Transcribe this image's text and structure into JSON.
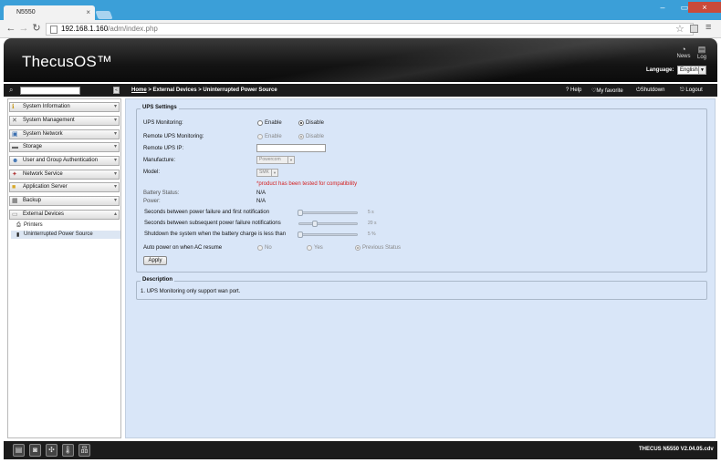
{
  "browser": {
    "tab_title": "N5550",
    "url_host": "192.168.1.160",
    "url_path": "/adm/index.php"
  },
  "header": {
    "logo": "ThecusOS™",
    "news": "News",
    "log": "Log",
    "language_label": "Language:",
    "language_value": "English"
  },
  "toolbar": {
    "breadcrumb_home": "Home",
    "breadcrumb_rest": " > External Devices > Uninterrupted Power Source",
    "help": "Help",
    "favorite": "My favorite",
    "shutdown": "Shutdown",
    "logout": "Logout"
  },
  "sidebar": {
    "items": [
      {
        "label": "System Information"
      },
      {
        "label": "System Management"
      },
      {
        "label": "System Network"
      },
      {
        "label": "Storage"
      },
      {
        "label": "User and Group Authentication"
      },
      {
        "label": "Network Service"
      },
      {
        "label": "Application Server"
      },
      {
        "label": "Backup"
      },
      {
        "label": "External Devices"
      }
    ],
    "sub_items": [
      {
        "label": "Printers"
      },
      {
        "label": "Uninterrupted Power Source"
      }
    ]
  },
  "ups": {
    "legend": "UPS Settings",
    "monitoring_label": "UPS Monitoring:",
    "enable": "Enable",
    "disable": "Disable",
    "remote_monitoring_label": "Remote UPS Monitoring:",
    "remote_ip_label": "Remote UPS IP:",
    "remote_ip_value": "",
    "manufacture_label": "Manufacture:",
    "manufacture_value": "Powercom",
    "model_label": "Model:",
    "model_value": "SMK",
    "compat_note": "*product has been tested for compatibility",
    "battery_label": "Battery Status:",
    "battery_value": "N/A",
    "power_label": "Power:",
    "power_value": "N/A",
    "first_notify_label": "Seconds between power failure and first notification",
    "first_notify_value": "5 s",
    "subsequent_label": "Seconds between subsequent power failure notifications",
    "subsequent_value": "20 s",
    "shutdown_label": "Shutdown the system when the battery charge is less than",
    "shutdown_value": "5 %",
    "auto_power_label": "Auto power on when AC resume",
    "no": "No",
    "yes": "Yes",
    "previous": "Previous Status",
    "apply": "Apply"
  },
  "description": {
    "legend": "Description",
    "text": "1. UPS Monitoring only support wan port."
  },
  "footer": {
    "version": "THECUS N5550 V2.04.05.cdv"
  }
}
